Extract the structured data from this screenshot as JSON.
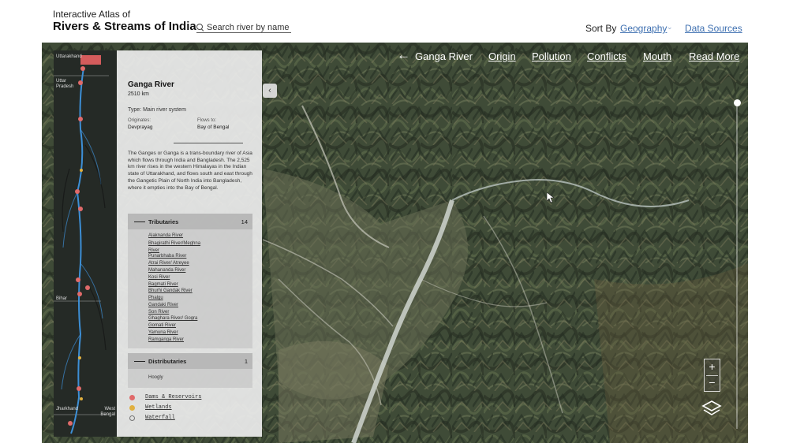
{
  "header": {
    "subtitle": "Interactive Atlas of",
    "title": "Rivers & Streams of India",
    "search_placeholder": "Search river by name",
    "sort_label": "Sort By",
    "sort_value": "Geography",
    "data_sources": "Data Sources"
  },
  "topnav": {
    "title": "Ganga River",
    "links": [
      "Origin",
      "Pollution",
      "Conflicts",
      "Mouth",
      "Read More"
    ]
  },
  "minimap": {
    "states": [
      "Uttarakhand",
      "Uttar Pradesh",
      "Bihar",
      "Jharkhand",
      "West Bengal"
    ]
  },
  "river": {
    "name": "Ganga River",
    "length": "2510 km",
    "type": "Type: Main river system",
    "originates_label": "Originates:",
    "originates_value": "Devprayag",
    "flows_label": "Flows to:",
    "flows_value": "Bay of Bengal",
    "description": "The Ganges or Ganga is a trans-boundary river of Asia which flows through India and Bangladesh. The 2,525 km river rises in the western Himalayas in the Indian state of Uttarakhand, and flows south and east through the Gangetic Plain of North India into Bangladesh, where it empties into the Bay of Bengal.",
    "tributaries_label": "Tributaries",
    "tributaries_count": "14",
    "tributaries": [
      "Alaknanda River",
      "Bhagirathi River/Meghna River",
      "Punarbhaba River",
      "Atrai River/ Atreyee",
      "Mahananda River",
      "Kosi River",
      "Bagmati River",
      "Bhurhi Gandak River",
      "Phalgu",
      "Gandaki River",
      "Son River",
      "Ghaghara River/ Gogra",
      "Gomati River",
      "Yamuna River",
      "Ramganga River"
    ],
    "distributaries_label": "Distributaries",
    "distributaries_count": "1",
    "distributaries": [
      "Hoogly"
    ]
  },
  "legend": [
    {
      "label": "Dams & Reservoirs",
      "color": "#e06a6a"
    },
    {
      "label": "Wetlands",
      "color": "#e0b040"
    },
    {
      "label": "Waterfall",
      "color": "#bbbbbb"
    }
  ],
  "colors": {
    "link": "#3d6fb0",
    "terrain": "#3e4a38",
    "river": "#cfd5cf",
    "minimap_river": "#3d8fd6"
  }
}
